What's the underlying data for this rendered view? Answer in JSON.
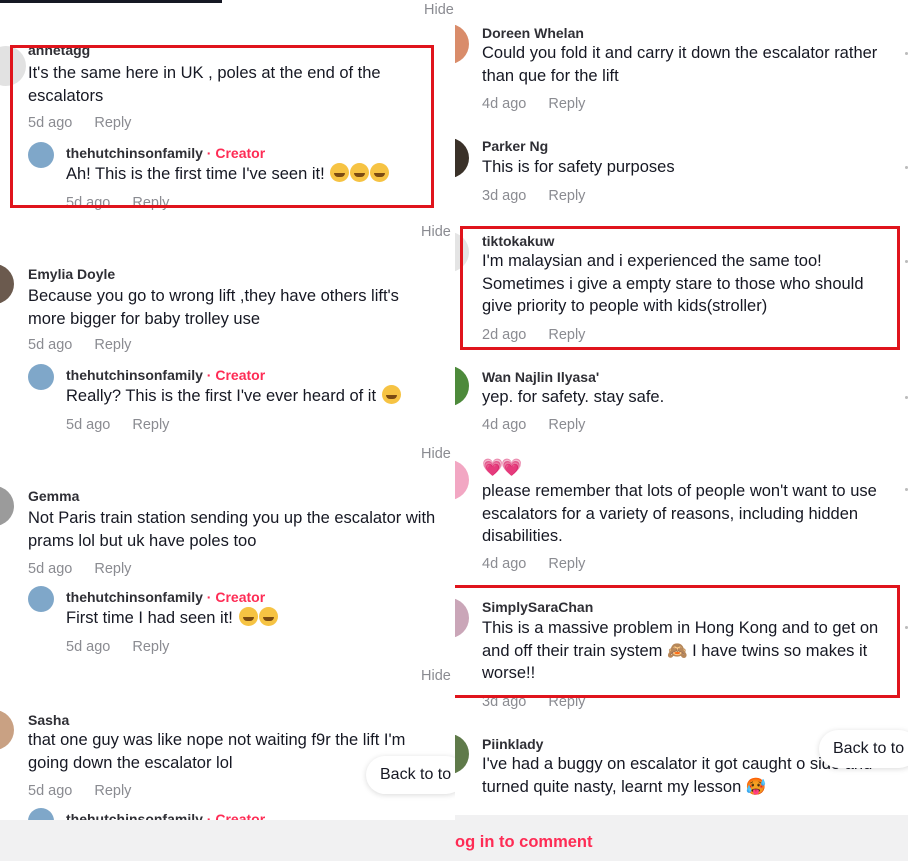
{
  "ui": {
    "hide_label": "Hide",
    "reply_label": "Reply",
    "back_to_top": "Back to to",
    "login_prompt": "og in to comment",
    "creator_badge": "· Creator",
    "accent": "#fe2c55",
    "highlight": "#e0141c"
  },
  "left_comments": [
    {
      "user": "annetagg",
      "text": "It's the same here in UK , poles at the end of the escalators",
      "age": "5d ago",
      "reply": {
        "user": "thehutchinsonfamily",
        "text": "Ah! This is the first time I've seen it!",
        "age": "5d ago"
      }
    },
    {
      "user": "Emylia Doyle",
      "text": "Because you go to wrong lift ,they have others lift's more bigger for baby trolley use",
      "age": "5d ago",
      "reply": {
        "user": "thehutchinsonfamily",
        "text": "Really? This is the first I've ever heard of it",
        "age": "5d ago"
      }
    },
    {
      "user": "Gemma",
      "text": "Not Paris train station sending you up the escalator with prams lol but uk have poles too",
      "age": "5d ago",
      "reply": {
        "user": "thehutchinsonfamily",
        "text": "First time I had seen it!",
        "age": "5d ago"
      }
    },
    {
      "user": "Sasha",
      "text": "that one guy was like nope not waiting f9r the lift I'm going down the escalator lol",
      "age": "5d ago",
      "reply": {
        "user": "thehutchinsonfamily",
        "text": "",
        "age": ""
      }
    }
  ],
  "right_comments": [
    {
      "user": "Doreen Whelan",
      "text": "Could you fold it and carry it down the escalator rather than que for the lift",
      "age": "4d ago"
    },
    {
      "user": "Parker Ng",
      "text": "This is for safety purposes",
      "age": "3d ago"
    },
    {
      "user": "tiktokakuw",
      "text": "I'm malaysian and i experienced the same too! Sometimes i give a empty stare to those who should give priority to people with kids(stroller)",
      "age": "2d ago"
    },
    {
      "user": "Wan Najlin Ilyasa'",
      "text": "yep. for safety. stay safe.",
      "age": "4d ago"
    },
    {
      "user": "💗💗",
      "text": "please remember that lots of people won't want to use escalators for a variety of reasons, including hidden disabilities.",
      "age": "4d ago"
    },
    {
      "user": "SimplySaraChan",
      "text": "This is a massive problem in Hong Kong and to get on and off their train system 🙈 I have twins so makes it worse!!",
      "age": "3d ago"
    },
    {
      "user": "Piinklady",
      "text": "I've had a buggy on escalator it got caught o side and turned quite nasty, learnt my lesson 🥵",
      "age": ""
    }
  ]
}
